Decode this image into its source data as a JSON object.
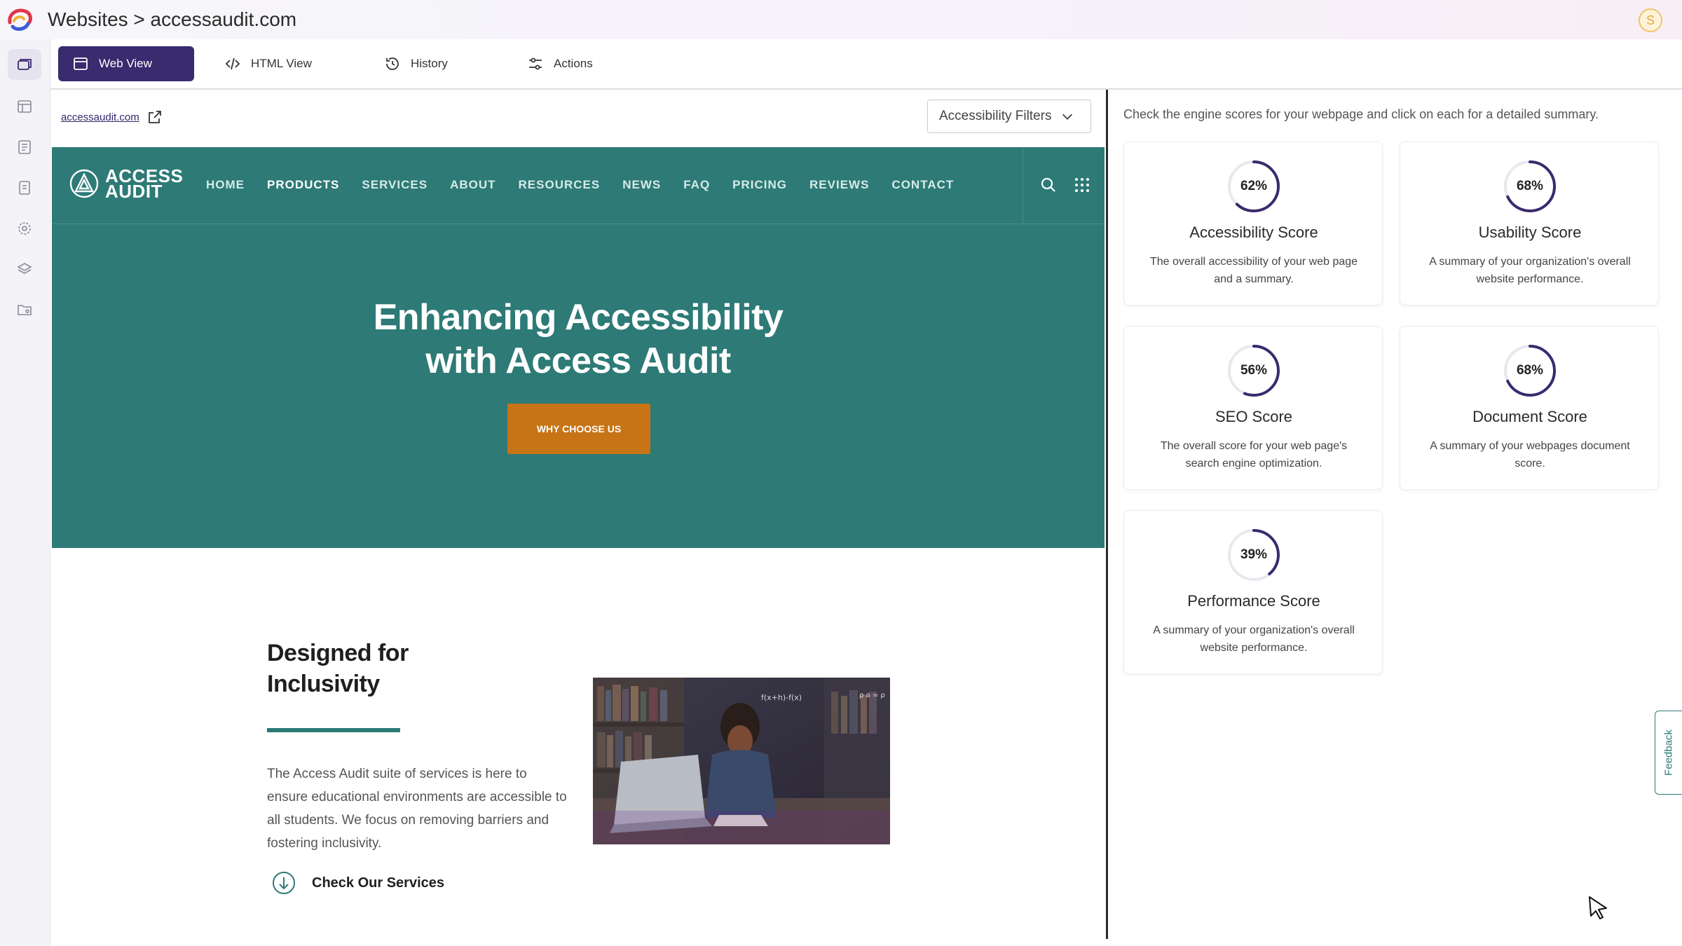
{
  "header": {
    "breadcrumb": "Websites > accessaudit.com",
    "user_initial": "S"
  },
  "sidebar": {
    "items": [
      {
        "icon": "pages-icon"
      },
      {
        "icon": "dashboard-icon"
      },
      {
        "icon": "report-icon"
      },
      {
        "icon": "document-icon"
      },
      {
        "icon": "settings-icon"
      },
      {
        "icon": "layers-icon"
      },
      {
        "icon": "folder-icon"
      }
    ]
  },
  "toolbar": {
    "tabs": [
      {
        "label": "Web View",
        "icon": "browser-window-icon",
        "active": true
      },
      {
        "label": "HTML View",
        "icon": "code-icon",
        "active": false
      },
      {
        "label": "History",
        "icon": "history-icon",
        "active": false
      },
      {
        "label": "Actions",
        "icon": "sliders-icon",
        "active": false
      }
    ]
  },
  "preview": {
    "url_link": "accessaudit.com",
    "filters_label": "Accessibility Filters",
    "site": {
      "logo_line1": "ACCESS",
      "logo_line2": "AUDIT",
      "nav": [
        "HOME",
        "PRODUCTS",
        "SERVICES",
        "ABOUT",
        "RESOURCES",
        "NEWS",
        "FAQ",
        "PRICING",
        "REVIEWS",
        "CONTACT"
      ],
      "hero_title_line1": "Enhancing Accessibility",
      "hero_title_line2": "with Access Audit",
      "hero_button": "WHY CHOOSE US",
      "section_title_line1": "Designed for",
      "section_title_line2": "Inclusivity",
      "section_body": "The Access Audit suite of services is here to ensure educational environments are accessible to all students. We focus on removing barriers and fostering inclusivity.",
      "cta": "Check Our Services",
      "photo_formula": "f(x+h)-f(x)",
      "photo_formula2": "ρ a = ρ"
    }
  },
  "scores": {
    "intro": "Check the engine scores for your webpage and click on each for a detailed summary.",
    "accent_color": "#3a2a6e",
    "cards": [
      {
        "percent": 62,
        "label": "62%",
        "title": "Accessibility Score",
        "desc": "The overall accessibility of your web page and a summary."
      },
      {
        "percent": 68,
        "label": "68%",
        "title": "Usability Score",
        "desc": "A summary of your organization's overall website performance."
      },
      {
        "percent": 56,
        "label": "56%",
        "title": "SEO Score",
        "desc": "The overall score for your web page's search engine optimization."
      },
      {
        "percent": 68,
        "label": "68%",
        "title": "Document Score",
        "desc": "A summary of your webpages document score."
      },
      {
        "percent": 39,
        "label": "39%",
        "title": "Performance Score",
        "desc": "A summary of your organization's overall website performance."
      }
    ]
  },
  "feedback_label": "Feedback"
}
